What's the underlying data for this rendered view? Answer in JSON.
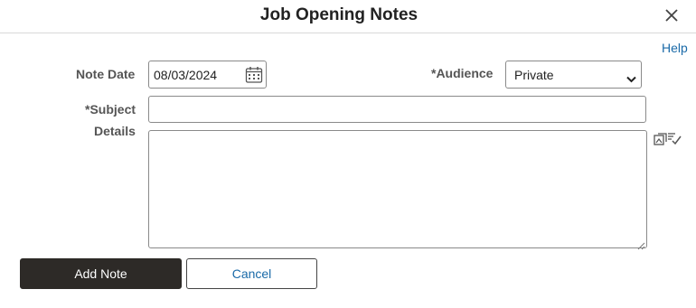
{
  "dialog": {
    "title": "Job Opening Notes",
    "help_label": "Help"
  },
  "form": {
    "note_date_label": "Note Date",
    "note_date_value": "08/03/2024",
    "audience_label": "*Audience",
    "audience_value": "Private",
    "subject_label": "*Subject",
    "subject_value": "",
    "details_label": "Details",
    "details_value": ""
  },
  "buttons": {
    "add_note": "Add Note",
    "cancel": "Cancel"
  },
  "icons": {
    "close": "close-icon",
    "calendar": "calendar-icon",
    "dropdown": "chevron-down-icon",
    "spell_check": "spell-check-icon"
  },
  "colors": {
    "primary_button": "#2d2a27",
    "link": "#1a6aa8"
  }
}
